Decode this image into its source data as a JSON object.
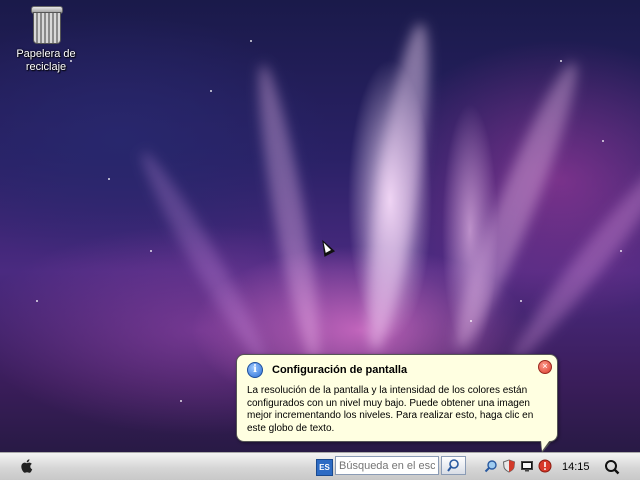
{
  "desktop": {
    "icons": [
      {
        "name": "trash-bin",
        "label": "Papelera de reciclaje"
      }
    ]
  },
  "balloon": {
    "title": "Configuración de pantalla",
    "body": "La resolución de la pantalla y la intensidad de los colores están configurados con un nivel muy bajo.  Puede obtener una imagen mejor incrementando los niveles. Para realizar esto, haga clic en este globo de texto."
  },
  "taskbar": {
    "language": "ES",
    "search_placeholder": "Búsqueda en el escritorio",
    "clock": "14:15"
  },
  "colors": {
    "balloon_bg": "#ffffe1",
    "taskbar_bg": "#d6d6d6",
    "alert_red": "#d8392a"
  }
}
